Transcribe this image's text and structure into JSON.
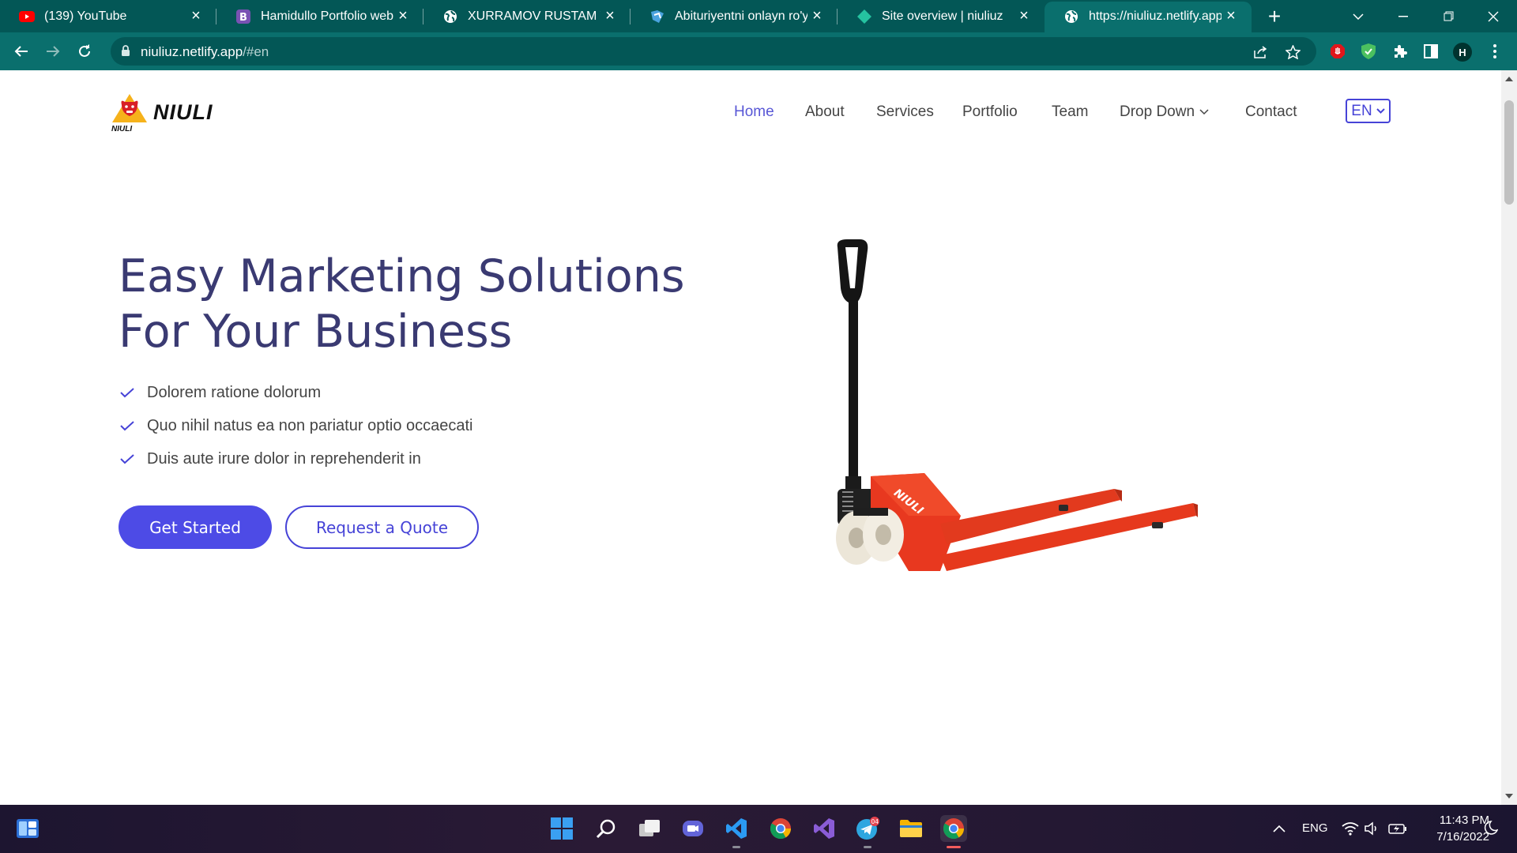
{
  "browser": {
    "tabs": [
      {
        "title": "(139) YouTube",
        "favicon": "youtube-icon"
      },
      {
        "title": "Hamidullo Portfolio web sit",
        "favicon": "bootstrap-icon"
      },
      {
        "title": "XURRAMOV RUSTAM YO'LD",
        "favicon": "globe-icon"
      },
      {
        "title": "Abituriyentni onlayn ro'yxat",
        "favicon": "site-icon"
      },
      {
        "title": "Site overview | niuliuz",
        "favicon": "netlify-icon"
      },
      {
        "title": "https://niuliuz.netlify.app/#",
        "favicon": "globe-icon",
        "active": true
      }
    ],
    "url_host": "niuliuz.netlify.app",
    "url_path": "/#en",
    "profile_initial": "H"
  },
  "site": {
    "logo_text": "NIULI",
    "logo_subtext": "NIULI",
    "nav": {
      "home": "Home",
      "about": "About",
      "services": "Services",
      "portfolio": "Portfolio",
      "team": "Team",
      "dropdown": "Drop Down",
      "contact": "Contact"
    },
    "language": "EN",
    "hero": {
      "title_line1": "Easy Marketing Solutions",
      "title_line2": "For Your Business",
      "bullets": [
        "Dolorem ratione dolorum",
        "Quo nihil natus ea non pariatur optio occaecati",
        "Duis aute irure dolor in reprehenderit in"
      ],
      "cta_primary": "Get Started",
      "cta_secondary": "Request a Quote",
      "image_brand": "NIULI"
    },
    "colors": {
      "accent": "#4d4be6",
      "title": "#3a3a72",
      "browser": "#0a6f6d"
    }
  },
  "taskbar": {
    "telegram_badge": "04",
    "language": "ENG",
    "time": "11:43 PM",
    "date": "7/16/2022"
  }
}
